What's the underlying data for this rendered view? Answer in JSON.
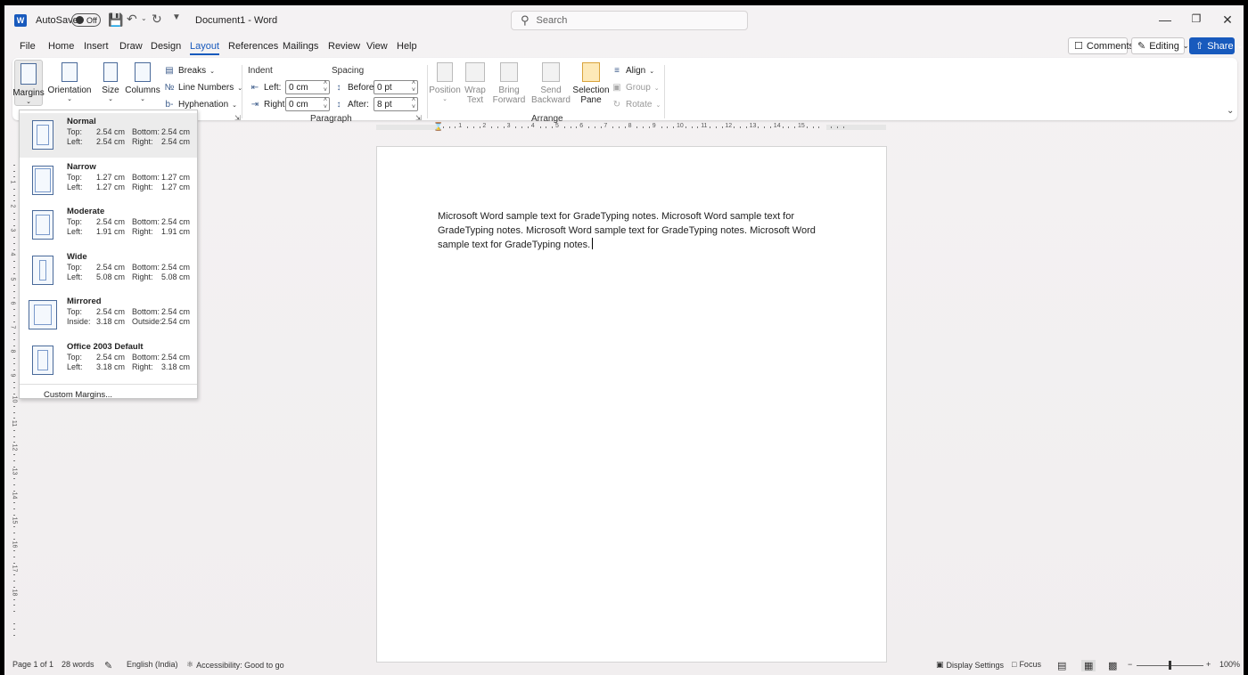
{
  "titlebar": {
    "autosave_label": "AutoSave",
    "autosave_state": "Off",
    "doc_title": "Document1 - Word",
    "search_placeholder": "Search"
  },
  "menu": {
    "tabs": [
      "File",
      "Home",
      "Insert",
      "Draw",
      "Design",
      "Layout",
      "References",
      "Mailings",
      "Review",
      "View",
      "Help"
    ],
    "active": "Layout",
    "comments": "Comments",
    "editing": "Editing",
    "share": "Share"
  },
  "ribbon": {
    "page_setup": {
      "margins": "Margins",
      "orientation": "Orientation",
      "size": "Size",
      "columns": "Columns",
      "breaks": "Breaks",
      "line_numbers": "Line Numbers",
      "hyphenation": "Hyphenation"
    },
    "paragraph": {
      "indent_label": "Indent",
      "spacing_label": "Spacing",
      "left_label": "Left:",
      "right_label": "Right:",
      "before_label": "Before:",
      "after_label": "After:",
      "left_value": "0 cm",
      "right_value": "0 cm",
      "before_value": "0 pt",
      "after_value": "8 pt",
      "group": "Paragraph"
    },
    "arrange": {
      "position": "Position",
      "wrap_text_1": "Wrap",
      "wrap_text_2": "Text",
      "bring_forward_1": "Bring",
      "bring_forward_2": "Forward",
      "send_backward_1": "Send",
      "send_backward_2": "Backward",
      "selection_pane_1": "Selection",
      "selection_pane_2": "Pane",
      "align": "Align",
      "group_btn": "Group",
      "rotate": "Rotate",
      "group": "Arrange"
    }
  },
  "margins_menu": {
    "presets": [
      {
        "name": "Normal",
        "l1": "Top:",
        "v1": "2.54 cm",
        "l2": "Bottom:",
        "v2": "2.54 cm",
        "l3": "Left:",
        "v3": "2.54 cm",
        "l4": "Right:",
        "v4": "2.54 cm"
      },
      {
        "name": "Narrow",
        "l1": "Top:",
        "v1": "1.27 cm",
        "l2": "Bottom:",
        "v2": "1.27 cm",
        "l3": "Left:",
        "v3": "1.27 cm",
        "l4": "Right:",
        "v4": "1.27 cm"
      },
      {
        "name": "Moderate",
        "l1": "Top:",
        "v1": "2.54 cm",
        "l2": "Bottom:",
        "v2": "2.54 cm",
        "l3": "Left:",
        "v3": "1.91 cm",
        "l4": "Right:",
        "v4": "1.91 cm"
      },
      {
        "name": "Wide",
        "l1": "Top:",
        "v1": "2.54 cm",
        "l2": "Bottom:",
        "v2": "2.54 cm",
        "l3": "Left:",
        "v3": "5.08 cm",
        "l4": "Right:",
        "v4": "5.08 cm"
      },
      {
        "name": "Mirrored",
        "l1": "Top:",
        "v1": "2.54 cm",
        "l2": "Bottom:",
        "v2": "2.54 cm",
        "l3": "Inside:",
        "v3": "3.18 cm",
        "l4": "Outside:",
        "v4": "2.54 cm"
      },
      {
        "name": "Office 2003 Default",
        "l1": "Top:",
        "v1": "2.54 cm",
        "l2": "Bottom:",
        "v2": "2.54 cm",
        "l3": "Left:",
        "v3": "3.18 cm",
        "l4": "Right:",
        "v4": "3.18 cm"
      }
    ],
    "custom": "Custom Margins..."
  },
  "ruler_numbers": [
    "1",
    "2",
    "3",
    "4",
    "5",
    "6",
    "7",
    "8",
    "9",
    "10",
    "11",
    "12",
    "13",
    "14",
    "15"
  ],
  "vruler_numbers": [
    "1",
    "2",
    "3",
    "4",
    "5",
    "6",
    "7",
    "8",
    "9",
    "10",
    "11",
    "12",
    "13",
    "14",
    "15",
    "16",
    "17",
    "18"
  ],
  "document": {
    "body": "Microsoft Word sample text for GradeTyping notes. Microsoft Word sample text for GradeTyping notes. Microsoft Word sample text for GradeTyping notes. Microsoft Word sample text for GradeTyping notes."
  },
  "statusbar": {
    "page": "Page 1 of 1",
    "words": "28 words",
    "language": "English (India)",
    "accessibility": "Accessibility: Good to go",
    "display_settings": "Display Settings",
    "focus": "Focus",
    "zoom": "100%"
  },
  "colors": {
    "accent": "#185abd"
  }
}
